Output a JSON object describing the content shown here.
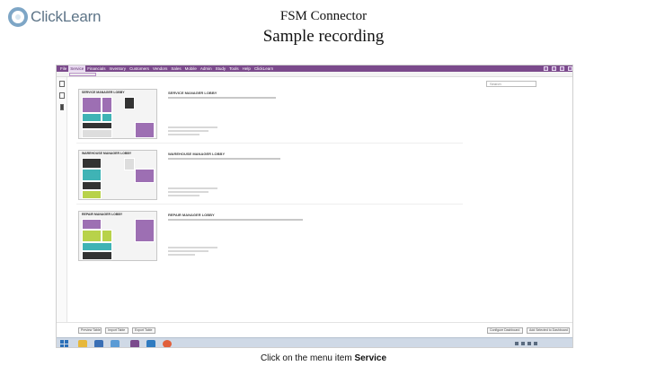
{
  "header": {
    "logo_text": "ClickLearn",
    "title": "FSM Connector",
    "subtitle": "Sample recording"
  },
  "app": {
    "menu": [
      "File",
      "Service",
      "Financials",
      "Inventory",
      "Customers",
      "Vendors",
      "Sales",
      "Mobile",
      "Admin",
      "Study",
      "Tools",
      "Help",
      "ClickLearn"
    ],
    "active_menu": "Service",
    "search_placeholder": "Search",
    "workspaces": [
      {
        "card_title": "SERVICE MANAGER LOBBY",
        "desc_title": "SERVICE MANAGER LOBBY"
      },
      {
        "card_title": "WAREHOUSE MANAGER LOBBY",
        "desc_title": "WAREHOUSE MANAGER LOBBY"
      },
      {
        "card_title": "REPAIR MANAGER LOBBY",
        "desc_title": "REPAIR MANAGER LOBBY"
      }
    ],
    "bottom_buttons": [
      "Preview Table",
      "Import Table",
      "Export Table",
      "Configure Dashboard",
      "Add Selected to Dashboard"
    ],
    "colors": {
      "menubar": "#7b4a8c",
      "purple": "#9d6fb3",
      "teal": "#3fb3b5",
      "dark": "#333333",
      "lime": "#b8d24a"
    }
  },
  "caption": {
    "prefix": "Click on the menu item ",
    "item": "Service"
  }
}
